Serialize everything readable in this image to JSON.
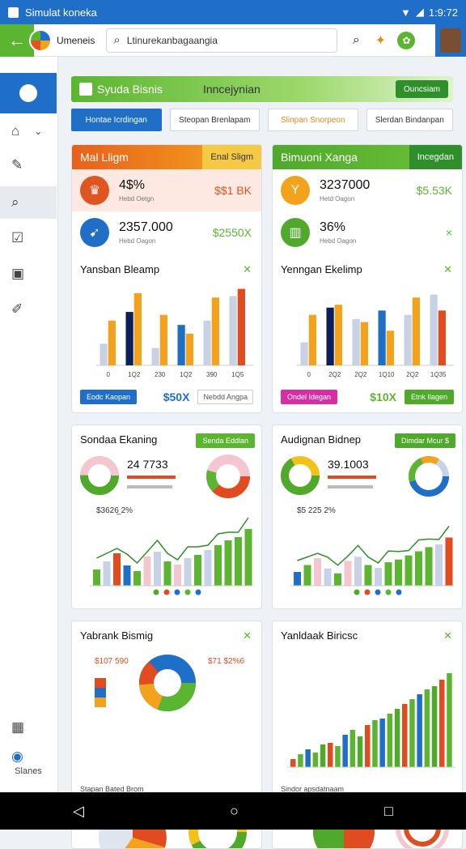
{
  "status": {
    "title": "Simulat konekа",
    "time": "1:9:72"
  },
  "appbar": {
    "app_name": "Umeneis",
    "search_value": "Ltinurekanbagaangia"
  },
  "sidebar": {
    "footer_label": "Slanes"
  },
  "banner": {
    "title": "Syuda Bisnis",
    "subtitle": "Inncejynian",
    "button": "Ouncsiam"
  },
  "tabs": [
    "Hontae Icrdingan",
    "Steopan Brenlapam",
    "Slinpan Snorpeon",
    "Slerdan Bindanpan"
  ],
  "card_left": {
    "header": "Mal Lligm",
    "header_tag": "Enal Sligm",
    "kpi1": {
      "value": "4$%",
      "label": "Hebd Oetgn",
      "right": "$$1 BK"
    },
    "kpi2": {
      "value": "2357.000",
      "label": "Hebd Oagon",
      "right": "$2550X"
    },
    "chart_title": "Yansban Bleamp",
    "btn1": "Eodc Kaopan",
    "mid_value": "$50X",
    "btn2": "Nebdd Angpa"
  },
  "card_right": {
    "header": "Bimuoni Xanga",
    "header_tag": "Incegdan",
    "kpi1": {
      "value": "3237000",
      "label": "Hetd Oagon",
      "right": "$5.53K"
    },
    "kpi2": {
      "value": "36%",
      "label": "Hebd Oagon",
      "right": "×"
    },
    "chart_title": "Yenngan Ekelimp",
    "btn1": "Ondel Idegan",
    "mid_value": "$10X",
    "btn2": "Etnk Ilagen"
  },
  "card_mid_left": {
    "title": "Sondaa Ekaning",
    "pill": "Senda Eddlan",
    "big": "24 7733",
    "line_label": "$3626̲ 2%"
  },
  "card_mid_right": {
    "title": "Audignan Bidnep",
    "pill": "Dimdar Mcur $",
    "big": "39.1003",
    "line_label": "$5 225 2%"
  },
  "card_bot_left": {
    "title": "Yabrank Bismig",
    "v1": "$107 590",
    "v2": "$71 $2%6",
    "legend": "Stapan Bated Brom"
  },
  "card_bot_right": {
    "title": "Yanldaak Biricsc",
    "legend": "Sindor apsdatnaam"
  },
  "colors": {
    "blue": "#1f6fc8",
    "green": "#5cb531",
    "orange": "#f08a1c",
    "red": "#e04b1f"
  },
  "chart_data": [
    {
      "type": "bar",
      "title": "Yansban Bleamp",
      "categories": [
        "0",
        "1Q2",
        "230",
        "1Q2",
        "390",
        "1Q5"
      ],
      "series": [
        {
          "values": [
            1.5,
            3.7,
            1.2,
            2.8,
            3.1,
            4.8
          ]
        },
        {
          "values": [
            3.1,
            5.0,
            3.5,
            2.2,
            4.7,
            5.3
          ]
        }
      ],
      "ylim": [
        0,
        5.5
      ]
    },
    {
      "type": "bar",
      "title": "Yenngan Ekelimp",
      "categories": [
        "0",
        "2Q2",
        "2Q2",
        "1Q10",
        "2Q2",
        "1Q35"
      ],
      "series": [
        {
          "values": [
            1.6,
            4.0,
            3.2,
            3.8,
            3.5,
            4.9
          ]
        },
        {
          "values": [
            3.5,
            4.2,
            3.0,
            2.4,
            4.7,
            3.8
          ]
        }
      ],
      "ylim": [
        0,
        5.5
      ]
    }
  ]
}
